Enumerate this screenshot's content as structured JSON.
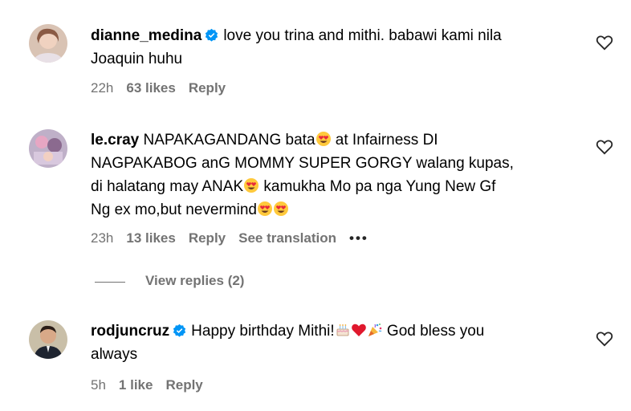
{
  "comments": [
    {
      "username": "dianne_medina",
      "verified": true,
      "text_line1": "love you trina and mithi. babawi kami nila",
      "text_line2": "Joaquin huhu",
      "time": "22h",
      "likes": "63 likes",
      "reply": "Reply"
    },
    {
      "username": "le.cray",
      "verified": false,
      "text_part1": "NAPAKAGANDANG bata",
      "text_part2": " at Infairness DI",
      "text_line2": "NAGPAKABOG anG MOMMY SUPER GORGY walang kupas,",
      "text_line3a": "di halatang may ANAK",
      "text_line3b": " kamukha Mo pa nga Yung New Gf",
      "text_line4": "Ng ex mo,but nevermind",
      "time": "23h",
      "likes": "13 likes",
      "reply": "Reply",
      "see_translation": "See translation",
      "more": "•••"
    },
    {
      "username": "rodjuncruz",
      "verified": true,
      "text_part1": "Happy birthday Mithi!",
      "text_part2": " God bless you",
      "text_line2": "always",
      "time": "5h",
      "likes": "1 like",
      "reply": "Reply"
    }
  ],
  "view_replies": "View replies (2)",
  "colors": {
    "meta": "#737373",
    "verified": "#0095f6"
  },
  "icons": [
    "heart-icon",
    "verified-badge-icon",
    "heart-eyes-emoji",
    "cake-emoji",
    "red-heart-emoji",
    "party-popper-emoji"
  ]
}
